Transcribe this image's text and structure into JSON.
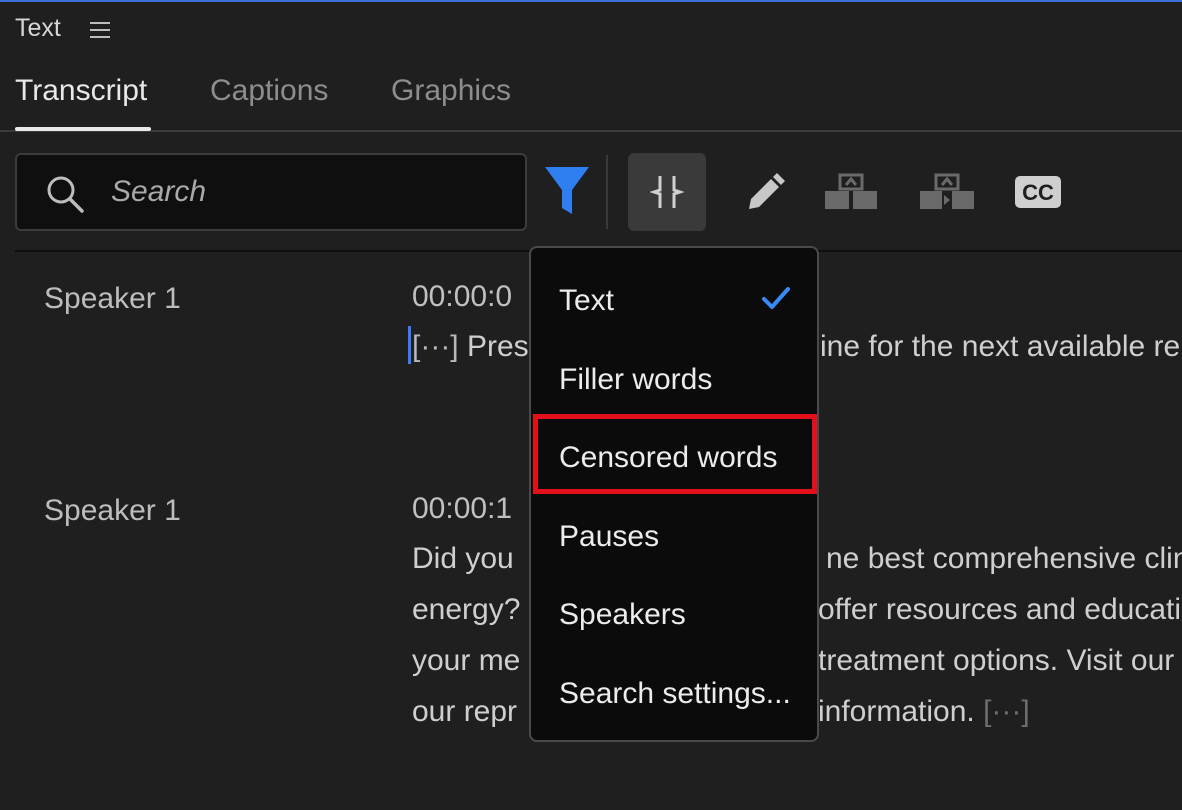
{
  "panel": {
    "title": "Text"
  },
  "tabs": [
    {
      "label": "Transcript",
      "active": true
    },
    {
      "label": "Captions",
      "active": false
    },
    {
      "label": "Graphics",
      "active": false
    }
  ],
  "search": {
    "placeholder": "Search",
    "value": ""
  },
  "toolbar": {
    "icons": [
      "filter-icon",
      "split-segment-icon",
      "edit-pencil-icon",
      "merge-segments-icon",
      "split-segments-icon",
      "closed-captions-icon"
    ],
    "filter_color": "#2f7ff0",
    "cc_label": "CC"
  },
  "transcript": [
    {
      "speaker": "Speaker 1",
      "time": "00:00:0",
      "lines": [
        {
          "ellipsis": "[···]",
          "text": " Pres",
          "right": "ine for the next available re"
        }
      ]
    },
    {
      "speaker": "Speaker 1",
      "time": "00:00:1",
      "lines": [
        {
          "left": "Did you",
          "right": "ne best comprehensive clin"
        },
        {
          "left": "energy?",
          "right": "offer resources and educatio"
        },
        {
          "left": "your me",
          "right": "treatment options. Visit our"
        },
        {
          "left": "our repr",
          "right": "information.",
          "ellipsis": "[···]"
        }
      ]
    }
  ],
  "filter_menu": {
    "items": [
      {
        "label": "Text",
        "checked": true
      },
      {
        "label": "Filler words",
        "checked": false
      },
      {
        "label": "Censored words",
        "checked": false,
        "highlighted": true
      },
      {
        "label": "Pauses",
        "checked": false
      },
      {
        "label": "Speakers",
        "checked": false
      },
      {
        "label": "Search settings...",
        "checked": false
      }
    ],
    "check_color": "#3a8af5",
    "highlight_color": "#e3101b"
  }
}
